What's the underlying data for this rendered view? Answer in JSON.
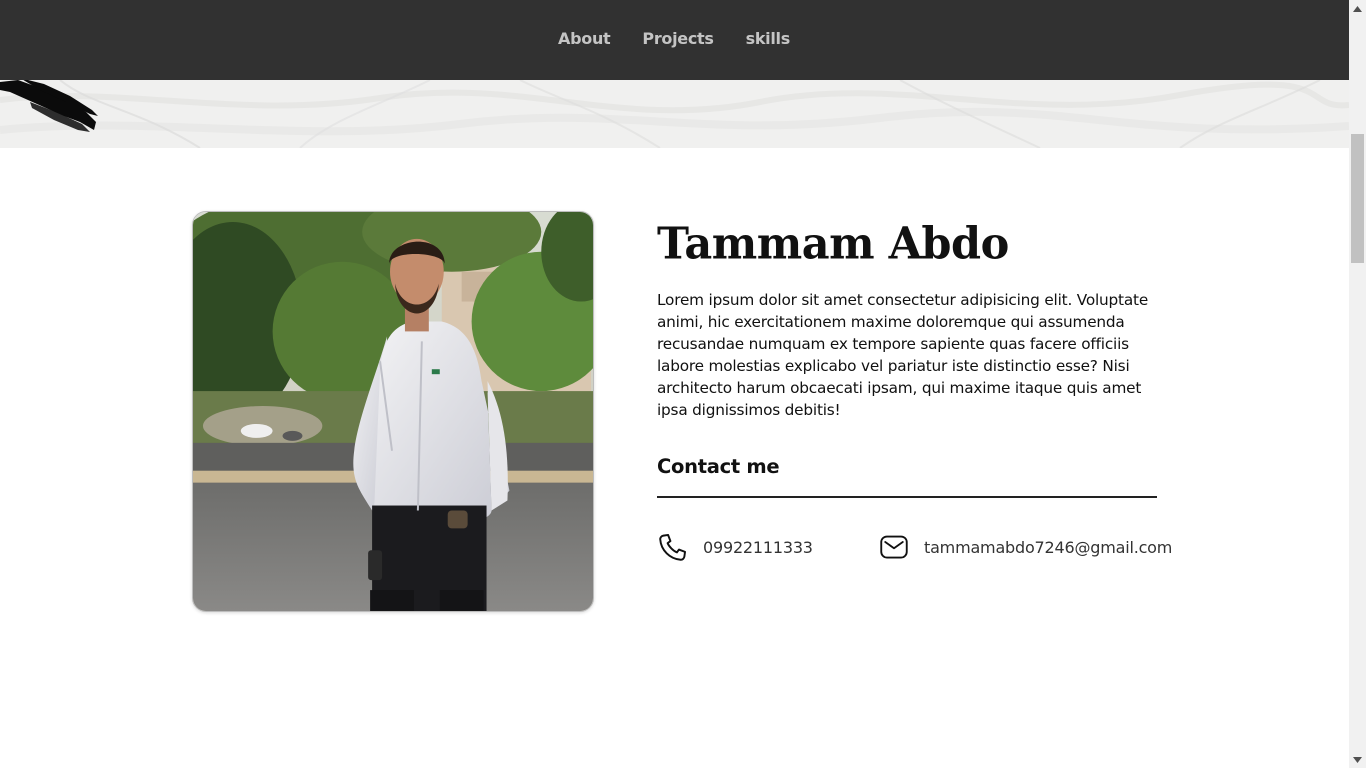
{
  "nav": {
    "items": [
      {
        "label": "About"
      },
      {
        "label": "Projects"
      },
      {
        "label": "skills"
      }
    ]
  },
  "profile": {
    "name": "Tammam Abdo",
    "bio": "Lorem ipsum dolor sit amet consectetur adipisicing elit. Voluptate animi, hic exercitationem maxime doloremque qui assumenda recusandae numquam ex tempore sapiente quas facere officiis labore molestias explicabo vel pariatur iste distinctio esse? Nisi architecto harum obcaecati ipsam, qui maxime itaque quis amet ipsa dignissimos debitis!"
  },
  "contact": {
    "title": "Contact me",
    "phone": "09922111333",
    "email": "tammamabdo7246@gmail.com",
    "phone_icon": "phone-icon",
    "email_icon": "envelope-icon"
  },
  "colors": {
    "navbar_bg": "#313131",
    "nav_text": "#c4c4c4",
    "page_bg": "#ffffff",
    "hero_band": "#f0f0ef"
  }
}
